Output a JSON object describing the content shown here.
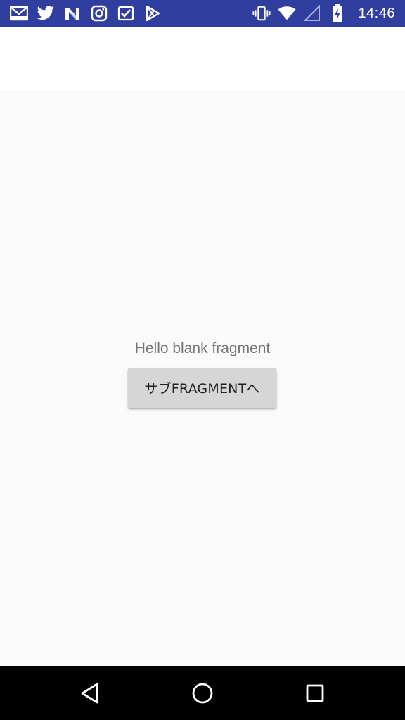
{
  "status_bar": {
    "background": "#303f9f",
    "left_icons": [
      "gmail-icon",
      "twitter-icon",
      "n-app-icon",
      "instagram-icon",
      "feedly-icon",
      "play-store-icon"
    ],
    "right_icons": [
      "vibrate-icon",
      "wifi-icon",
      "signal-icon",
      "battery-charging-icon"
    ],
    "time": "14:46"
  },
  "app_bar": {
    "background": "#ffffff"
  },
  "content": {
    "hello_text": "Hello blank fragment",
    "button_label": "サブFRAGMENTへ"
  },
  "nav_bar": {
    "items": [
      "back-icon",
      "home-icon",
      "recents-icon"
    ]
  }
}
